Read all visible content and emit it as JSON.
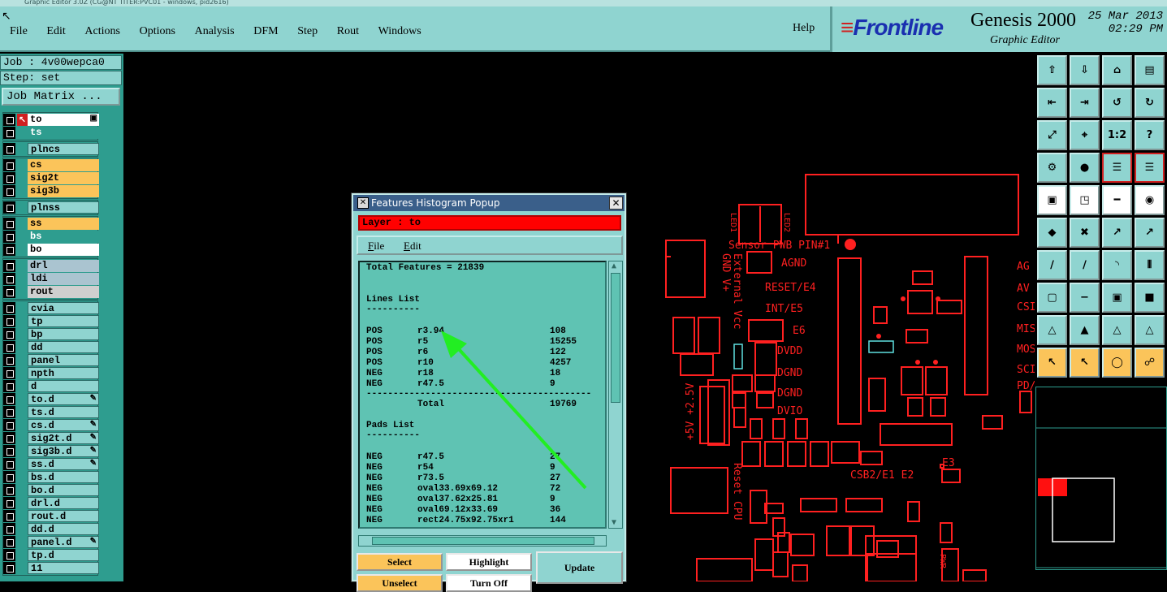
{
  "window": {
    "title": "Graphic Editor 3.0Z (CG@NT TITER:PVC01 - windows, pid2616)"
  },
  "menubar": {
    "items": [
      "File",
      "Edit",
      "Actions",
      "Options",
      "Analysis",
      "DFM",
      "Step",
      "Rout",
      "Windows"
    ],
    "help": "Help"
  },
  "brand": {
    "logo": "Frontline",
    "product": "Genesis 2000",
    "subtitle": "Graphic Editor",
    "date": "25 Mar 2013",
    "time": "02:29 PM"
  },
  "job": {
    "job_label": "Job : 4v00wepca0",
    "step_label": "Step: set",
    "matrix_button": "Job Matrix ..."
  },
  "layers": [
    {
      "name": "to",
      "color": "white",
      "special": "active"
    },
    {
      "name": "ts",
      "color": "green"
    },
    {
      "name": "plncs",
      "color": "cyan"
    },
    {
      "name": "cs",
      "color": "orange"
    },
    {
      "name": "sig2t",
      "color": "orange"
    },
    {
      "name": "sig3b",
      "color": "orange"
    },
    {
      "name": "plnss",
      "color": "cyan"
    },
    {
      "name": "ss",
      "color": "orange"
    },
    {
      "name": "bs",
      "color": "green"
    },
    {
      "name": "bo",
      "color": "white"
    },
    {
      "name": "drl",
      "color": "blue"
    },
    {
      "name": "ldi",
      "color": "blue"
    },
    {
      "name": "rout",
      "color": "gray"
    },
    {
      "name": "cvia",
      "color": "cyan"
    },
    {
      "name": "tp",
      "color": "cyan"
    },
    {
      "name": "bp",
      "color": "cyan"
    },
    {
      "name": "dd",
      "color": "cyan"
    },
    {
      "name": "panel",
      "color": "cyan"
    },
    {
      "name": "npth",
      "color": "cyan"
    },
    {
      "name": "d",
      "color": "cyan"
    },
    {
      "name": "to.d",
      "color": "cyan",
      "pen": true
    },
    {
      "name": "ts.d",
      "color": "cyan"
    },
    {
      "name": "cs.d",
      "color": "cyan",
      "pen": true
    },
    {
      "name": "sig2t.d",
      "color": "cyan",
      "pen": true
    },
    {
      "name": "sig3b.d",
      "color": "cyan",
      "pen": true
    },
    {
      "name": "ss.d",
      "color": "cyan",
      "pen": true
    },
    {
      "name": "bs.d",
      "color": "cyan"
    },
    {
      "name": "bo.d",
      "color": "cyan"
    },
    {
      "name": "drl.d",
      "color": "cyan"
    },
    {
      "name": "rout.d",
      "color": "cyan"
    },
    {
      "name": "dd.d",
      "color": "cyan"
    },
    {
      "name": "panel.d",
      "color": "cyan",
      "pen": true
    },
    {
      "name": "tp.d",
      "color": "cyan"
    },
    {
      "name": "11",
      "color": "cyan"
    }
  ],
  "popup": {
    "title": "Features Histogram Popup",
    "layer_label": "Layer :  to",
    "menu": [
      "File",
      "Edit"
    ],
    "total_features": "Total Features = 21839",
    "lines_header": "Lines List",
    "lines": [
      {
        "pol": "POS",
        "sym": "r3.94",
        "count": "108"
      },
      {
        "pol": "POS",
        "sym": "r5",
        "count": "15255"
      },
      {
        "pol": "POS",
        "sym": "r6",
        "count": "122"
      },
      {
        "pol": "POS",
        "sym": "r10",
        "count": "4257"
      },
      {
        "pol": "NEG",
        "sym": "r18",
        "count": "18"
      },
      {
        "pol": "NEG",
        "sym": "r47.5",
        "count": "9"
      }
    ],
    "lines_total_label": "Total",
    "lines_total": "19769",
    "pads_header": "Pads List",
    "pads": [
      {
        "pol": "NEG",
        "sym": "r47.5",
        "count": "27"
      },
      {
        "pol": "NEG",
        "sym": "r54",
        "count": "9"
      },
      {
        "pol": "NEG",
        "sym": "r73.5",
        "count": "27"
      },
      {
        "pol": "NEG",
        "sym": "oval33.69x69.12",
        "count": "72"
      },
      {
        "pol": "NEG",
        "sym": "oval37.62x25.81",
        "count": "9"
      },
      {
        "pol": "NEG",
        "sym": "oval69.12x33.69",
        "count": "36"
      },
      {
        "pol": "NEG",
        "sym": "rect24.75x92.75xr1",
        "count": "144"
      }
    ],
    "buttons": {
      "select": "Select",
      "highlight": "Highlight",
      "update": "Update",
      "unselect": "Unselect",
      "turn_off": "Turn Off"
    }
  },
  "silkscreen": {
    "labels": [
      "LED1",
      "LED2",
      "Sensor PWB PIN#1",
      "External",
      "GND V+",
      "Vcc",
      "AGND",
      "RESET/E4",
      "INT/E5",
      "E6",
      "DVDD",
      "DGND",
      "DGND",
      "DVIO",
      "+5V +2.5V",
      "Reset CPU",
      "CSB2/E1 E2",
      "E3",
      "AG",
      "AV",
      "CSI",
      "MIS",
      "MOS",
      "SCI",
      "PD/",
      "PWR"
    ]
  },
  "colors": {
    "panel_cyan": "#8fd4d0",
    "panel_green": "#2e9d8f",
    "layer_orange": "#fbc45a",
    "features_red": "#ff0000",
    "annotation_arrow": "#22ee22"
  }
}
